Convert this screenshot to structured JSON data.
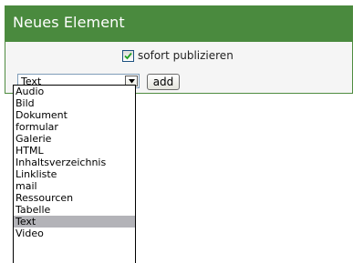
{
  "panel": {
    "title": "Neues Element",
    "header_color": "#4a8a3e"
  },
  "publish": {
    "label": "sofort publizieren",
    "checked": true
  },
  "select": {
    "value": "Text",
    "options": [
      "Audio",
      "Bild",
      "Dokument",
      "formular",
      "Galerie",
      "HTML",
      "Inhaltsverzeichnis",
      "Linkliste",
      "mail",
      "Ressourcen",
      "Tabelle",
      "Text",
      "Video"
    ],
    "selected_option": "Text",
    "highlight_color": "#b3b3b8"
  },
  "add_button": {
    "label": "add"
  }
}
